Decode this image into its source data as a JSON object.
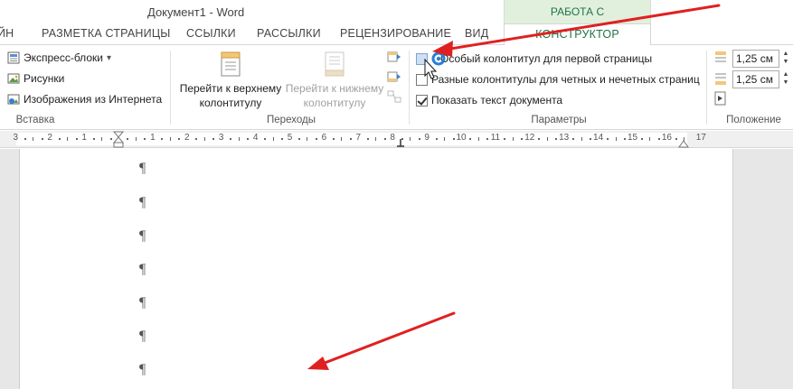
{
  "window": {
    "title": "Документ1 - Word"
  },
  "context_header": {
    "label": "РАБОТА С КОЛОНТИТУЛАМИ"
  },
  "tabs": [
    {
      "label": "ЙН"
    },
    {
      "label": "РАЗМЕТКА СТРАНИЦЫ"
    },
    {
      "label": "ССЫЛКИ"
    },
    {
      "label": "РАССЫЛКИ"
    },
    {
      "label": "РЕЦЕНЗИРОВАНИЕ"
    },
    {
      "label": "ВИД"
    },
    {
      "label": "КОНСТРУКТОР",
      "active": true
    }
  ],
  "ribbon": {
    "insert_group": {
      "label": "Вставка",
      "items": [
        {
          "label": "Экспресс-блоки",
          "dropdown": "▾",
          "icon": "quick-parts-icon"
        },
        {
          "label": "Рисунки",
          "icon": "pictures-icon"
        },
        {
          "label": "Изображения из Интернета",
          "icon": "online-pictures-icon"
        }
      ]
    },
    "navigation_group": {
      "label": "Переходы",
      "goto_header": {
        "line1": "Перейти к верхнему",
        "line2": "колонтитулу"
      },
      "goto_footer": {
        "line1": "Перейти к нижнему",
        "line2": "колонтитулу"
      }
    },
    "options_group": {
      "label": "Параметры",
      "options": [
        {
          "label": "Особый колонтитул для первой страницы",
          "checked": false
        },
        {
          "label": "Разные колонтитулы для четных и нечетных страниц",
          "checked": false
        },
        {
          "label": "Показать текст документа",
          "checked": true
        }
      ]
    },
    "position_group": {
      "label": "Положение",
      "header_from_top": "1,25 см",
      "footer_from_bottom": "1,25 см"
    }
  },
  "ruler": {
    "numbers": [
      "3",
      "2",
      "1",
      "1",
      "2",
      "3",
      "4",
      "5",
      "6",
      "7",
      "8",
      "9",
      "10",
      "11",
      "12",
      "13",
      "14",
      "15",
      "16",
      "17"
    ]
  },
  "document": {
    "paragraph_mark": "¶",
    "paragraph_count": 7
  },
  "colors": {
    "accent": "#217346",
    "context_tab_bg": "#e1f0dd",
    "annotation_arrow": "#e02020",
    "page_bg": "#ffffff",
    "workspace_bg": "#e7e7e7"
  }
}
